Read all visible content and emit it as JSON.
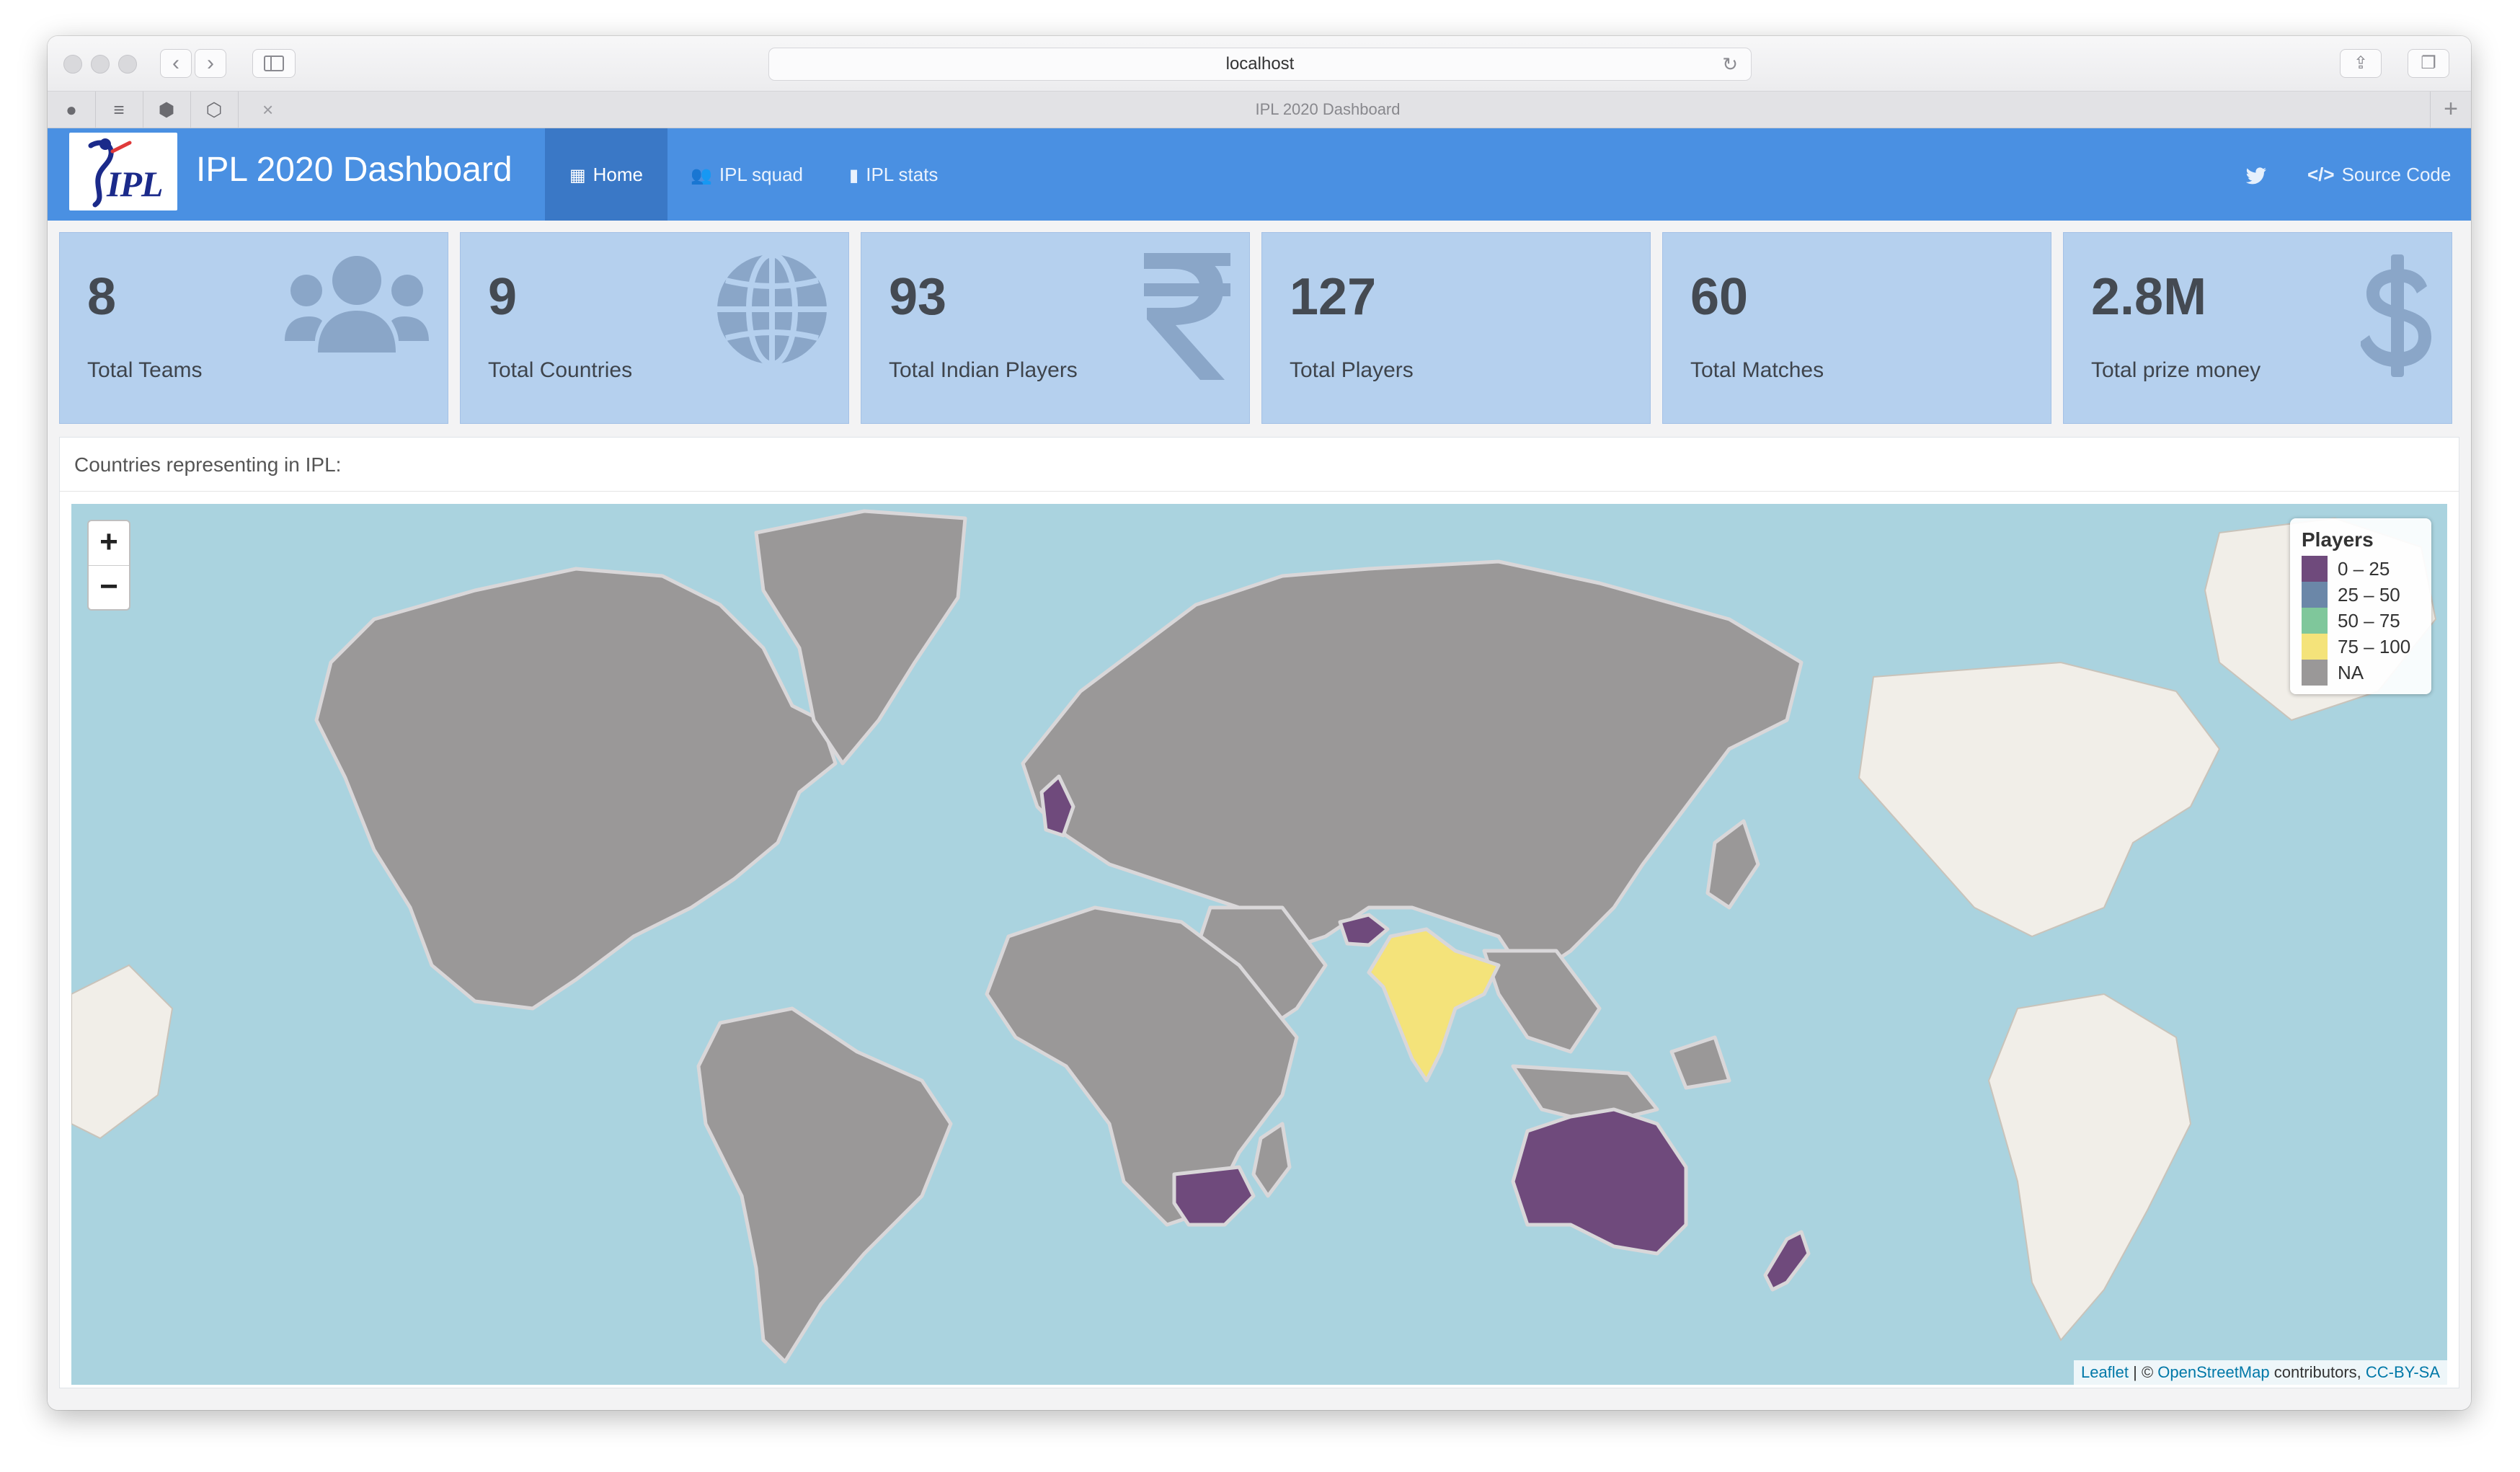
{
  "browser": {
    "url": "localhost",
    "tab_title": "IPL 2020 Dashboard"
  },
  "navbar": {
    "logo_text": "IPL",
    "brand": "IPL 2020 Dashboard",
    "items": [
      {
        "label": "Home",
        "icon": "table-icon",
        "active": true
      },
      {
        "label": "IPL squad",
        "icon": "users-icon",
        "active": false
      },
      {
        "label": "IPL stats",
        "icon": "bar-chart-icon",
        "active": false
      }
    ],
    "twitter_icon": "twitter-icon",
    "source_code": "Source Code"
  },
  "stats": [
    {
      "value": "8",
      "label": "Total Teams",
      "icon": "users-icon"
    },
    {
      "value": "9",
      "label": "Total Countries",
      "icon": "globe-icon"
    },
    {
      "value": "93",
      "label": "Total Indian Players",
      "icon": "rupee-icon"
    },
    {
      "value": "127",
      "label": "Total Players",
      "icon": ""
    },
    {
      "value": "60",
      "label": "Total Matches",
      "icon": ""
    },
    {
      "value": "2.8M",
      "label": "Total prize money",
      "icon": "dollar-icon"
    }
  ],
  "map": {
    "title": "Countries representing in IPL:",
    "zoom_in": "+",
    "zoom_out": "−",
    "legend_title": "Players",
    "legend": [
      {
        "label": "0 – 25",
        "color": "#6f4a7c"
      },
      {
        "label": "25 – 50",
        "color": "#6b87a8"
      },
      {
        "label": "50 – 75",
        "color": "#7fc79b"
      },
      {
        "label": "75 – 100",
        "color": "#f4e37a"
      },
      {
        "label": "NA",
        "color": "#9a9898"
      }
    ],
    "attribution": {
      "leaflet": "Leaflet",
      "sep": " | © ",
      "osm": "OpenStreetMap",
      "contrib": " contributors, ",
      "license": "CC-BY-SA"
    },
    "colors": {
      "water": "#aad3df",
      "na": "#9a9898",
      "low": "#6f4a7c",
      "high": "#f4e37a",
      "land": "#f1eee8"
    }
  },
  "colors": {
    "navbar": "#4a90e2",
    "nav_active": "#3a78c6",
    "card": "#b5d0ee"
  }
}
